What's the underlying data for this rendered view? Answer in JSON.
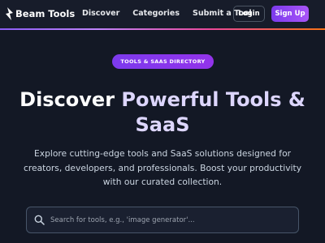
{
  "brand": {
    "name": "Beam Tools",
    "icon": "lightning-bolt-icon"
  },
  "nav": {
    "links": [
      "Discover",
      "Categories",
      "Submit a Tool"
    ],
    "login_label": "Login",
    "signup_label": "Sign Up"
  },
  "hero": {
    "badge": "TOOLS & SAAS DIRECTORY",
    "title_part1": "Discover ",
    "title_part2": "Powerful Tools & SaaS",
    "description": "Explore cutting-edge tools and SaaS solutions designed for creators, developers, and professionals. Boost your productivity with our curated collection."
  },
  "search": {
    "placeholder": "Search for tools, e.g., 'image generator'...",
    "icon": "search-icon"
  },
  "colors": {
    "background": "#131825",
    "navbar": "#171c2a",
    "accent_purple": "#7c3aed",
    "accent_gradient": [
      "#8b5cf6",
      "#c084fc",
      "#ec4899",
      "#f97316"
    ],
    "title_highlight": "#ddd6fe"
  }
}
